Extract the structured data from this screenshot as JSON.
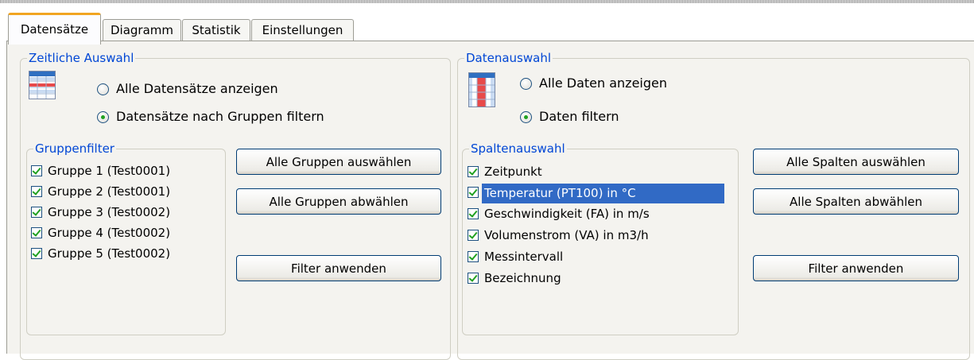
{
  "tabs": [
    {
      "label": "Datensätze",
      "active": true
    },
    {
      "label": "Diagramm"
    },
    {
      "label": "Statistik"
    },
    {
      "label": "Einstellungen"
    }
  ],
  "time_selection": {
    "title": "Zeitliche Auswahl",
    "icon": "table-rows-icon",
    "option_all": "Alle Datensätze anzeigen",
    "option_filter": "Datensätze nach Gruppen filtern",
    "selected": "filter"
  },
  "group_filter": {
    "title": "Gruppenfilter",
    "items": [
      {
        "label": "Gruppe 1 (Test0001)",
        "checked": true
      },
      {
        "label": "Gruppe 2 (Test0001)",
        "checked": true
      },
      {
        "label": "Gruppe 3 (Test0002)",
        "checked": true
      },
      {
        "label": "Gruppe 4 (Test0002)",
        "checked": true
      },
      {
        "label": "Gruppe 5 (Test0002)",
        "checked": true
      }
    ],
    "select_all": "Alle Gruppen auswählen",
    "deselect_all": "Alle Gruppen abwählen",
    "apply": "Filter anwenden"
  },
  "data_selection": {
    "title": "Datenauswahl",
    "icon": "table-columns-icon",
    "option_all": "Alle Daten anzeigen",
    "option_filter": "Daten filtern",
    "selected": "filter"
  },
  "column_selection": {
    "title": "Spaltenauswahl",
    "items": [
      {
        "label": "Zeitpunkt",
        "checked": true
      },
      {
        "label": "Temperatur (PT100) in °C",
        "checked": true,
        "highlighted": true
      },
      {
        "label": "Geschwindigkeit (FA) in m/s",
        "checked": true
      },
      {
        "label": "Volumenstrom (VA) in m3/h",
        "checked": true
      },
      {
        "label": "Messintervall",
        "checked": true
      },
      {
        "label": "Bezeichnung",
        "checked": true
      }
    ],
    "select_all": "Alle Spalten auswählen",
    "deselect_all": "Alle Spalten abwählen",
    "apply": "Filter anwenden"
  },
  "colors": {
    "legend_blue": "#0046d5",
    "selection_blue": "#316ac5",
    "check_green": "#21a121",
    "tab_accent": "#f1a521",
    "icon_red": "#e84a4a"
  }
}
